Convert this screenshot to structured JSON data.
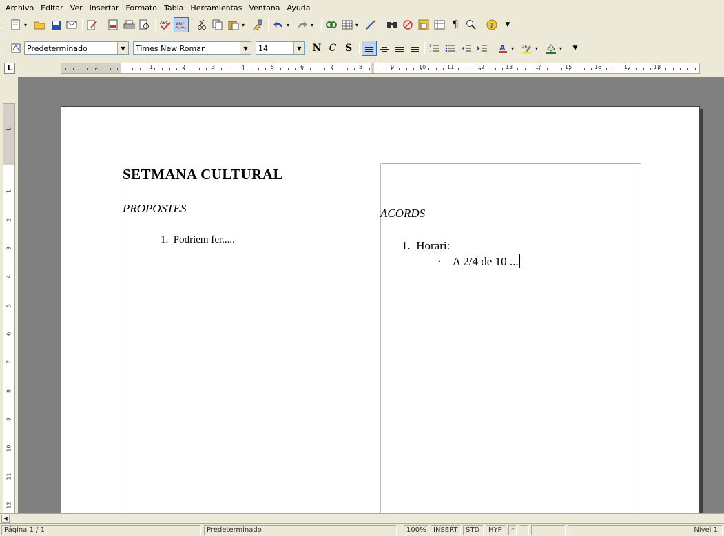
{
  "menu": [
    "Archivo",
    "Editar",
    "Ver",
    "Insertar",
    "Formato",
    "Tabla",
    "Herramientas",
    "Ventana",
    "Ayuda"
  ],
  "format_toolbar": {
    "style": "Predeterminado",
    "font": "Times New Roman",
    "size": "14",
    "bold": "N",
    "italic": "C",
    "underline": "S"
  },
  "ruler_numbers": [
    "1",
    "1",
    "2",
    "3",
    "4",
    "5",
    "6",
    "7",
    "8",
    "9",
    "10",
    "11",
    "12",
    "13",
    "14",
    "15",
    "16",
    "17",
    "18"
  ],
  "vruler_numbers": [
    "1",
    "1",
    "2",
    "3",
    "4",
    "5",
    "6",
    "7",
    "8",
    "9",
    "10",
    "11",
    "12"
  ],
  "document": {
    "title": "SETMANA CULTURAL",
    "left_heading": "PROPOSTES",
    "left_item_num": "1.",
    "left_item": "Podriem fer.....",
    "right_heading": "ACORDS",
    "right_item_num": "1.",
    "right_item": "Horari:",
    "right_bullet": "·",
    "right_subitem": "A 2/4 de 10 ..."
  },
  "status": {
    "page": "Página 1 / 1",
    "style": "Predeterminado",
    "zoom": "100%",
    "mode": "INSERT",
    "sel": "STD",
    "hyp": "HYP",
    "star": "*",
    "level": "Nivel 1"
  }
}
